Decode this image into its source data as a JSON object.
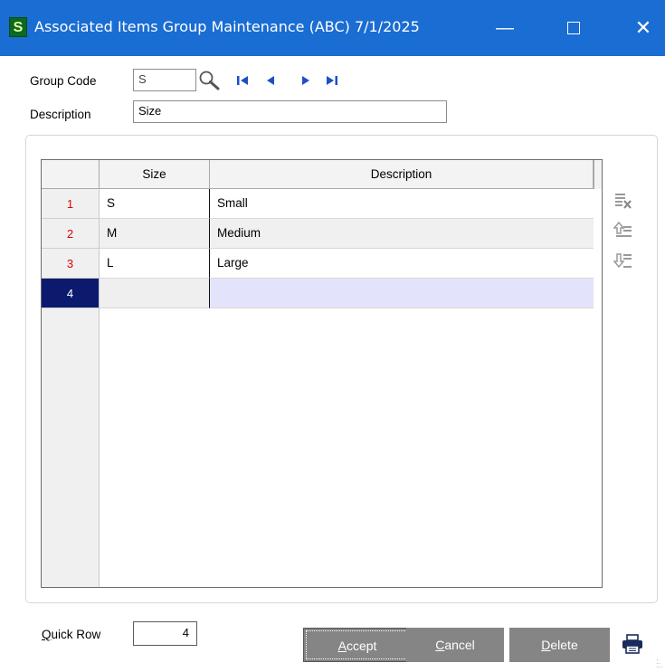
{
  "window": {
    "app_icon_letter": "S",
    "title": "Associated Items Group Maintenance (ABC) 7/1/2025",
    "minimize_glyph": "—",
    "close_glyph": "✕"
  },
  "header": {
    "group_code_label": "Group Code",
    "group_code_value": "S",
    "description_label": "Description",
    "description_value": "Size"
  },
  "grid": {
    "columns": [
      "Size",
      "Description"
    ],
    "rows": [
      {
        "num": "1",
        "size": "S",
        "description": "Small"
      },
      {
        "num": "2",
        "size": "M",
        "description": "Medium"
      },
      {
        "num": "3",
        "size": "L",
        "description": "Large"
      },
      {
        "num": "4",
        "size": "",
        "description": ""
      }
    ],
    "current_row": "4"
  },
  "side_icons": [
    "delete-row-icon",
    "insert-row-above-icon",
    "insert-row-below-icon"
  ],
  "footer": {
    "quick_row_label_prefix": "Q",
    "quick_row_label_rest": "uick Row",
    "quick_row_value": "4",
    "accept_mnemonic": "A",
    "accept_rest": "ccept",
    "cancel_mnemonic": "C",
    "cancel_rest": "ancel",
    "delete_mnemonic": "D",
    "delete_rest": "elete"
  },
  "colors": {
    "titlebar": "#1a6dd3",
    "current_row_marker": "#0c1a6e",
    "row_number_text": "#e00000",
    "button_bg": "#858585"
  }
}
